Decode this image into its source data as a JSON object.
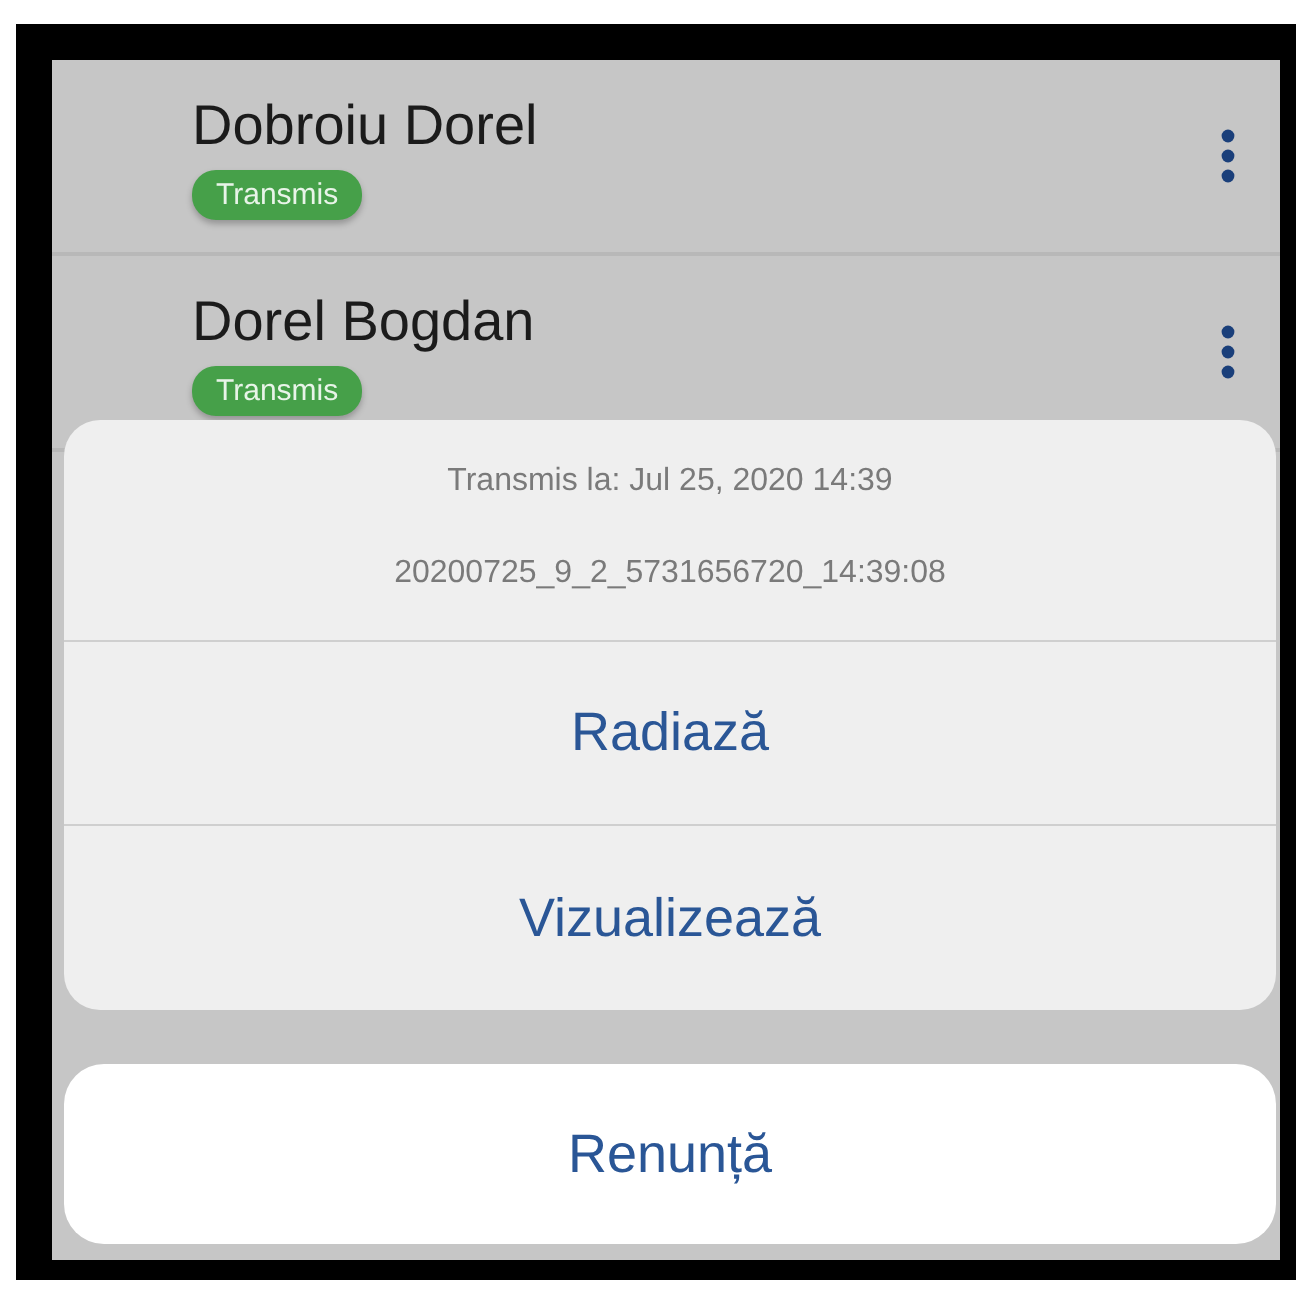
{
  "list": [
    {
      "name": "Dobroiu Dorel",
      "status": "Transmis"
    },
    {
      "name": "Dorel Bogdan",
      "status": "Transmis"
    }
  ],
  "action_sheet": {
    "info": [
      "Transmis la: Jul 25, 2020 14:39",
      "20200725_9_2_5731656720_14:39:08"
    ],
    "actions": [
      "Radiază",
      "Vizualizează"
    ],
    "cancel": "Renunță"
  }
}
